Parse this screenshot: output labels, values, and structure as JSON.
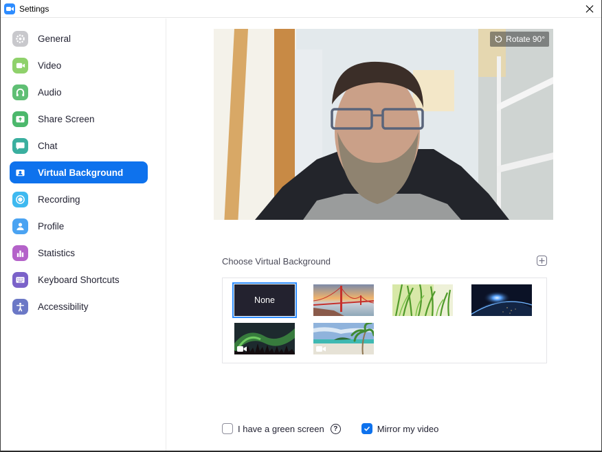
{
  "window": {
    "title": "Settings",
    "close_icon": "close-icon"
  },
  "sidebar": {
    "items": [
      {
        "label": "General",
        "icon": "gear-icon",
        "color": "#c8c8cc",
        "active": false
      },
      {
        "label": "Video",
        "icon": "video-camera-icon",
        "color": "#8fd16b",
        "active": false
      },
      {
        "label": "Audio",
        "icon": "headphones-icon",
        "color": "#5fbf74",
        "active": false
      },
      {
        "label": "Share Screen",
        "icon": "share-screen-icon",
        "color": "#4cb86c",
        "active": false
      },
      {
        "label": "Chat",
        "icon": "chat-bubble-icon",
        "color": "#3aaf9f",
        "active": false
      },
      {
        "label": "Virtual Background",
        "icon": "person-card-icon",
        "color": "#0e72ed",
        "active": true
      },
      {
        "label": "Recording",
        "icon": "record-icon",
        "color": "#3eb9f0",
        "active": false
      },
      {
        "label": "Profile",
        "icon": "person-icon",
        "color": "#4aa3f2",
        "active": false
      },
      {
        "label": "Statistics",
        "icon": "bar-chart-icon",
        "color": "#b462c9",
        "active": false
      },
      {
        "label": "Keyboard Shortcuts",
        "icon": "keyboard-icon",
        "color": "#7b62c9",
        "active": false
      },
      {
        "label": "Accessibility",
        "icon": "accessibility-icon",
        "color": "#6b78c6",
        "active": false
      }
    ]
  },
  "preview": {
    "rotate_label": "Rotate 90°"
  },
  "backgrounds": {
    "section_label": "Choose Virtual Background",
    "add_icon": "plus-icon",
    "items": [
      {
        "label": "None",
        "kind": "none",
        "selected": true
      },
      {
        "label": "Golden Gate Bridge",
        "kind": "image",
        "selected": false
      },
      {
        "label": "Grass",
        "kind": "image",
        "selected": false
      },
      {
        "label": "Earth from space",
        "kind": "image",
        "selected": false
      },
      {
        "label": "Northern lights",
        "kind": "video",
        "selected": false
      },
      {
        "label": "Beach",
        "kind": "video",
        "selected": false
      }
    ]
  },
  "options": {
    "green_screen": {
      "label": "I have a green screen",
      "checked": false,
      "help": "?"
    },
    "mirror": {
      "label": "Mirror my video",
      "checked": true
    }
  },
  "colors": {
    "accent": "#0e72ed",
    "selected_outline": "#2d8cff"
  }
}
